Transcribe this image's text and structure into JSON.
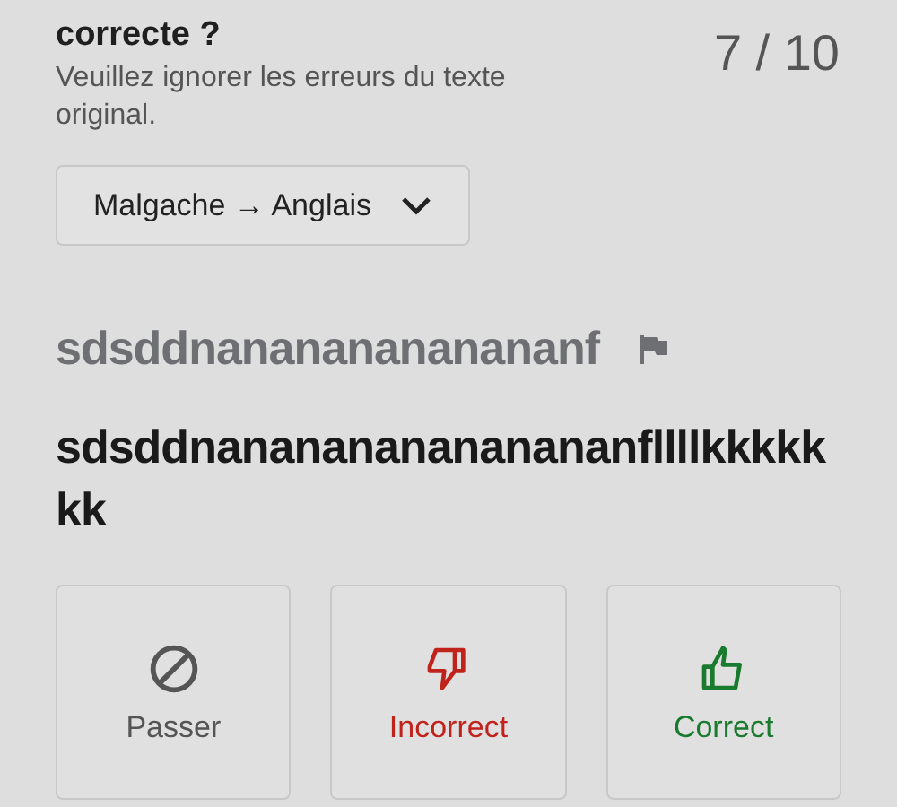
{
  "header": {
    "title": "correcte ?",
    "subtitle": "Veuillez ignorer les erreurs du texte original.",
    "counter": "7 / 10"
  },
  "language_dropdown": {
    "label": "Malgache → Anglais"
  },
  "source_text": "sdsddnanananananananf",
  "translation": "sdsddnananananananananfllllkkkkkkk",
  "buttons": [
    {
      "kind": "skip",
      "label": "Passer"
    },
    {
      "kind": "incorrect",
      "label": "Incorrect"
    },
    {
      "kind": "correct",
      "label": "Correct"
    }
  ]
}
